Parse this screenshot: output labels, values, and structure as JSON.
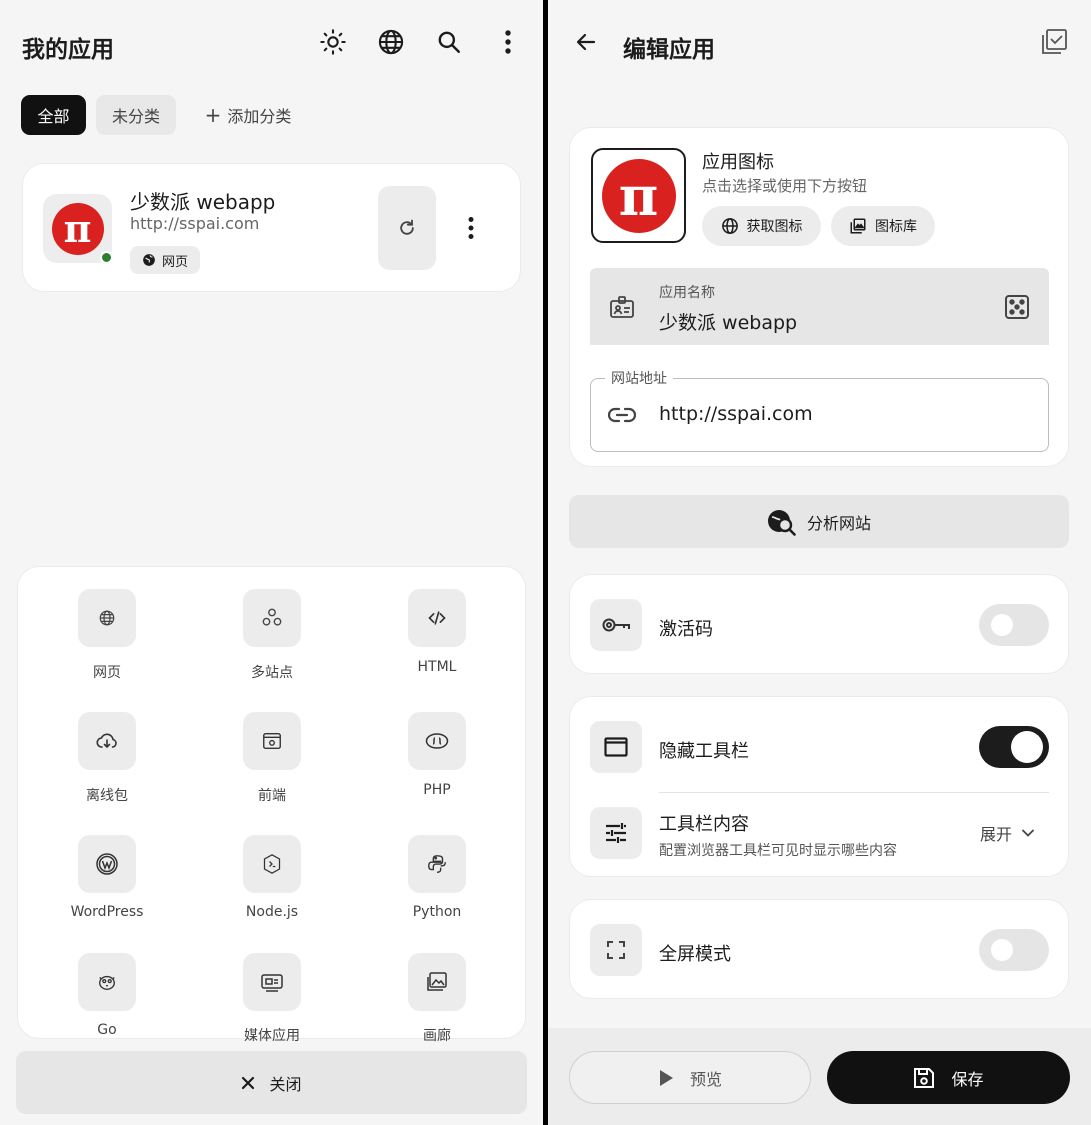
{
  "left": {
    "header": {
      "title": "我的应用"
    },
    "tabs": {
      "all": "全部",
      "uncategorized": "未分类",
      "add_category": "添加分类"
    },
    "app_card": {
      "name": "少数派 webapp",
      "url": "http://sspai.com",
      "type_badge": "网页",
      "status": "online",
      "icon_letter": "π"
    },
    "app_types": [
      {
        "label": "网页",
        "icon": "globe-icon"
      },
      {
        "label": "多站点",
        "icon": "multi-site-icon"
      },
      {
        "label": "HTML",
        "icon": "code-icon"
      },
      {
        "label": "离线包",
        "icon": "cloud-download-icon"
      },
      {
        "label": "前端",
        "icon": "frontend-icon"
      },
      {
        "label": "PHP",
        "icon": "php-icon"
      },
      {
        "label": "WordPress",
        "icon": "wordpress-icon"
      },
      {
        "label": "Node.js",
        "icon": "nodejs-icon"
      },
      {
        "label": "Python",
        "icon": "python-icon"
      },
      {
        "label": "Go",
        "icon": "gopher-icon"
      },
      {
        "label": "媒体应用",
        "icon": "media-icon"
      },
      {
        "label": "画廊",
        "icon": "gallery-icon"
      }
    ],
    "close_button": "关闭"
  },
  "right": {
    "header": {
      "title": "编辑应用"
    },
    "icon_section": {
      "title": "应用图标",
      "hint": "点击选择或使用下方按钮",
      "fetch_button": "获取图标",
      "library_button": "图标库"
    },
    "name_field": {
      "label": "应用名称",
      "value": "少数派 webapp"
    },
    "url_field": {
      "label": "网站地址",
      "value": "http://sspai.com"
    },
    "analyze_button": "分析网站",
    "activation": {
      "label": "激活码",
      "enabled": false
    },
    "hide_toolbar": {
      "label": "隐藏工具栏",
      "enabled": true
    },
    "toolbar_content": {
      "label": "工具栏内容",
      "desc": "配置浏览器工具栏可见时显示哪些内容",
      "value": "展开"
    },
    "fullscreen": {
      "label": "全屏模式",
      "enabled": false
    },
    "preview_button": "预览",
    "save_button": "保存"
  },
  "colors": {
    "accent": "#1c1c1c",
    "logo_red": "#d9211f",
    "status_green": "#2e7d32",
    "surface": "#f5f5f5"
  }
}
